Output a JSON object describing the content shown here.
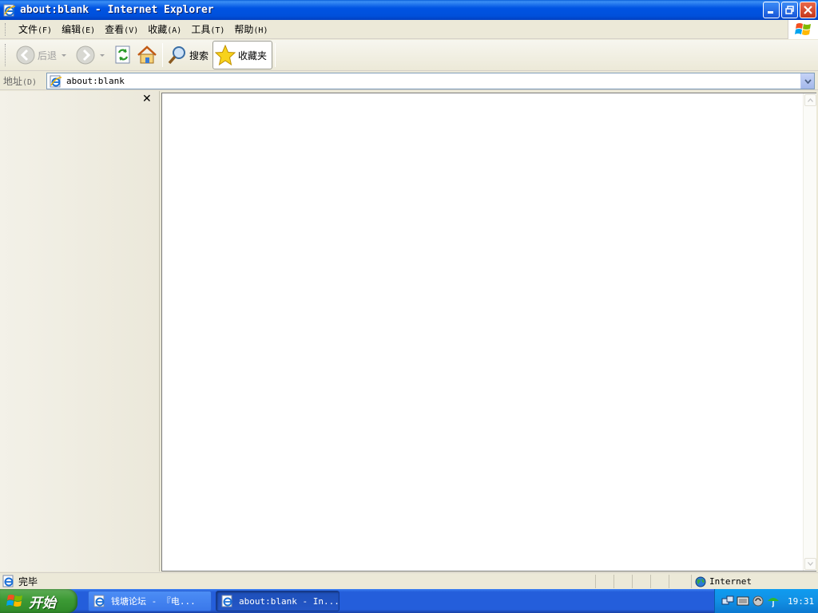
{
  "window": {
    "title": "about:blank - Internet Explorer"
  },
  "menu": {
    "items": [
      {
        "label": "文件",
        "accel": "(F)"
      },
      {
        "label": "编辑",
        "accel": "(E)"
      },
      {
        "label": "查看",
        "accel": "(V)"
      },
      {
        "label": "收藏",
        "accel": "(A)"
      },
      {
        "label": "工具",
        "accel": "(T)"
      },
      {
        "label": "帮助",
        "accel": "(H)"
      }
    ]
  },
  "toolbar": {
    "back_label": "后退",
    "search_label": "搜索",
    "favorites_label": "收藏夹"
  },
  "address": {
    "label": "地址",
    "accel": "(D)",
    "value": "about:blank"
  },
  "status": {
    "text": "完毕",
    "zone": "Internet"
  },
  "taskbar": {
    "start_label": "开始",
    "tasks": [
      {
        "label": "钱塘论坛 - 『电...",
        "active": false
      },
      {
        "label": "about:blank - In...",
        "active": true
      }
    ],
    "clock": "19:31"
  },
  "colors": {
    "titlebar": "#0054e3",
    "taskbar": "#245edb",
    "start": "#3c9a35",
    "tray": "#1290e4"
  }
}
